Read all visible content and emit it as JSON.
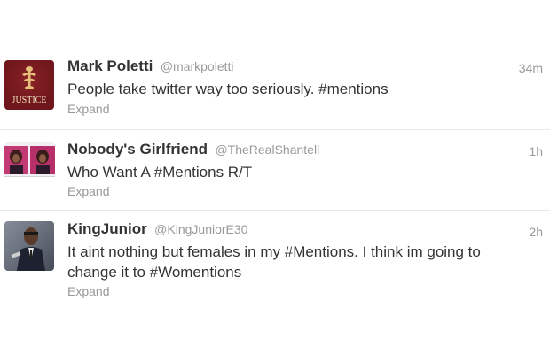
{
  "tweets": [
    {
      "name": "Mark Poletti",
      "handle": "@markpoletti",
      "time": "34m",
      "text": "People take twitter way too seriously. #mentions",
      "expand": "Expand",
      "avatar_text": "JUSTICE",
      "avatar_color": "#7a1a1f"
    },
    {
      "name": "Nobody's Girlfriend",
      "handle": "@TheRealShantell",
      "time": "1h",
      "text": "Who Want A #Mentions R/T",
      "expand": "Expand",
      "avatar_color": "#b0205a"
    },
    {
      "name": "KingJunior",
      "handle": "@KingJuniorE30",
      "time": "2h",
      "text": "It aint nothing but females in my #Mentions. I think im going to change it to #Womentions",
      "expand": "Expand",
      "avatar_color": "#2b2f3a"
    }
  ]
}
